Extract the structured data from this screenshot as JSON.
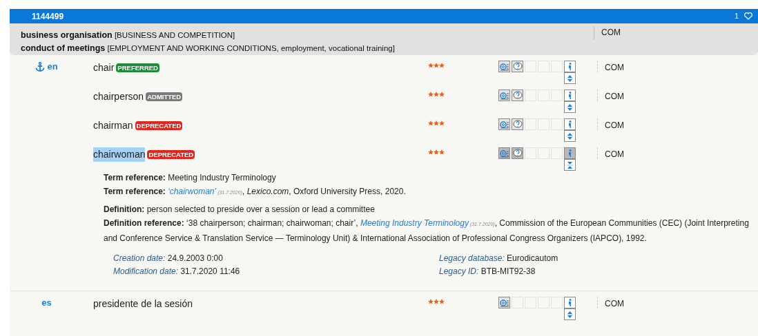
{
  "header": {
    "id": "1144499",
    "count": "1"
  },
  "domains": [
    {
      "name": "business organisation",
      "path": "[BUSINESS AND COMPETITION]"
    },
    {
      "name": "conduct of meetings",
      "path": "[EMPLOYMENT AND WORKING CONDITIONS, employment, vocational training]"
    }
  ],
  "domain_owner": "COM",
  "languages": [
    {
      "code": "en",
      "anchor": true,
      "terms": [
        {
          "term": "chair",
          "status": {
            "text": "PREFERRED",
            "color": "#1e8a3c"
          },
          "selected": false,
          "stars": 3,
          "tools": [
            {
              "kind": "reference"
            },
            {
              "kind": "note"
            }
          ],
          "owner": "COM"
        },
        {
          "term": "chairperson",
          "status": {
            "text": "ADMITTED",
            "color": "#7a7a7a"
          },
          "selected": false,
          "stars": 3,
          "tools": [
            {
              "kind": "reference"
            },
            {
              "kind": "note"
            }
          ],
          "owner": "COM"
        },
        {
          "term": "chairman",
          "status": {
            "text": "DEPRECATED",
            "color": "#e0271f"
          },
          "selected": false,
          "stars": 3,
          "tools": [
            {
              "kind": "reference"
            },
            {
              "kind": "note"
            }
          ],
          "owner": "COM"
        },
        {
          "term": "chairwoman",
          "status": {
            "text": "DEPRECATED",
            "color": "#e0271f"
          },
          "selected": true,
          "stars": 3,
          "tools": [
            {
              "kind": "reference"
            },
            {
              "kind": "note"
            }
          ],
          "owner": "COM",
          "details": {
            "groups": [
              [
                {
                  "label": "Term reference:",
                  "segments": [
                    {
                      "kind": "text",
                      "text": "Meeting Industry Terminology"
                    }
                  ]
                },
                {
                  "label": "Term reference:",
                  "segments": [
                    {
                      "kind": "link",
                      "text": "‘chairwoman’"
                    },
                    {
                      "kind": "date",
                      "text": "(31.7.2020)"
                    },
                    {
                      "kind": "text",
                      "text": ", *Lexico.com*, Oxford University Press, 2020."
                    }
                  ]
                }
              ],
              [
                {
                  "label": "Definition:",
                  "segments": [
                    {
                      "kind": "text",
                      "text": "person selected to preside over a session or lead a committee"
                    }
                  ]
                },
                {
                  "label": "Definition reference:",
                  "segments": [
                    {
                      "kind": "text",
                      "text": "‘38 chairperson; chairman; chairwoman; chair’, "
                    },
                    {
                      "kind": "link",
                      "text": "Meeting Industry Terminology"
                    },
                    {
                      "kind": "date",
                      "text": "(31.7.2020)"
                    },
                    {
                      "kind": "text",
                      "text": ", Commission of the European Communities (CEC) (Joint Interpreting and Conference Service & Translation Service — Terminology Unit) & International Association of Professional Congress Organizers (IAPCO), 1992."
                    }
                  ]
                }
              ]
            ],
            "meta_left": [
              {
                "label": "Creation date:",
                "value": "24.9.2003 0:00"
              },
              {
                "label": "Modification date:",
                "value": "31.7.2020 11:46"
              }
            ],
            "meta_right": [
              {
                "label": "Legacy database:",
                "value": "Eurodicautom"
              },
              {
                "label": "Legacy ID:",
                "value": "BTB-MIT92-38"
              }
            ]
          }
        }
      ]
    },
    {
      "code": "es",
      "anchor": false,
      "terms": [
        {
          "term": "presidente de la sesión",
          "selected": false,
          "stars": 3,
          "tools": [
            {
              "kind": "reference"
            }
          ],
          "owner": "COM"
        }
      ]
    }
  ]
}
